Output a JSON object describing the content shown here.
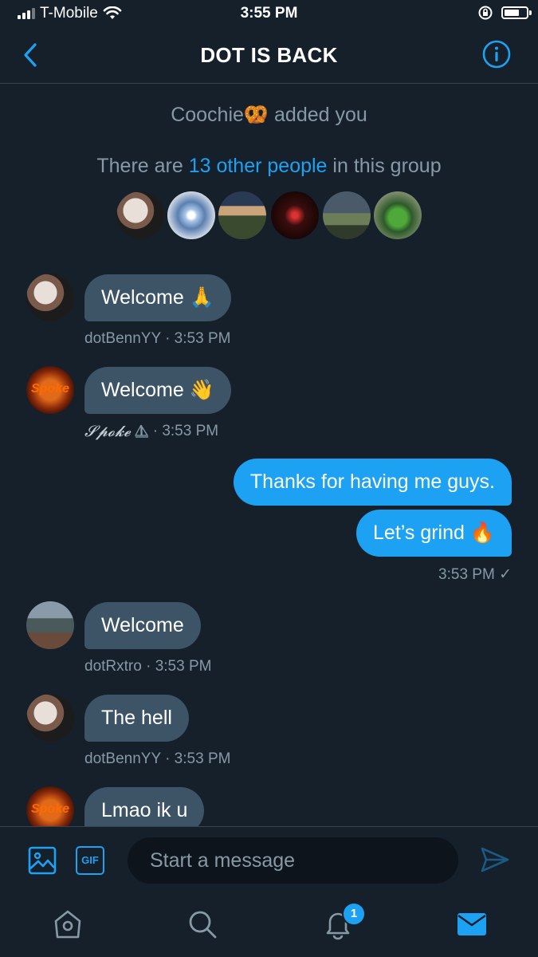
{
  "status_bar": {
    "carrier": "T-Mobile",
    "time": "3:55 PM",
    "battery_level": 0.7
  },
  "header": {
    "title": "DOT IS BACK"
  },
  "system": {
    "added_name": "Coochie",
    "added_emoji": "🥨",
    "added_text": "added you",
    "group_prefix": "There are",
    "group_link": "13 other people",
    "group_suffix": "in this group"
  },
  "messages": [
    {
      "text": "Welcome 🙏",
      "sender": "dotBennYY",
      "time": "· 3:53 PM"
    },
    {
      "text": "Welcome 👋",
      "sender": "𝓢𝓹𝓸𝓴𝓮",
      "sender_icon": "sailboat-icon",
      "time": "· 3:53 PM"
    },
    {
      "text": "Thanks for having me guys.",
      "outgoing": true
    },
    {
      "text": "Let’s grind 🔥",
      "outgoing": true,
      "time": "3:53 PM",
      "status": "✓"
    },
    {
      "text": "Welcome",
      "sender": "dotRxtro",
      "time": "· 3:53 PM"
    },
    {
      "text": "The hell",
      "sender": "dotBennYY",
      "time": "· 3:53 PM"
    },
    {
      "text": "Lmao ik u"
    }
  ],
  "avatar_labels": {
    "spoke": "Spoke"
  },
  "composer": {
    "placeholder": "Start a message",
    "gif_label": "GIF"
  },
  "tabbar": {
    "notification_count": "1"
  },
  "colors": {
    "background": "#15202b",
    "accent": "#1da1f2",
    "incoming_bubble": "#3d5466"
  }
}
